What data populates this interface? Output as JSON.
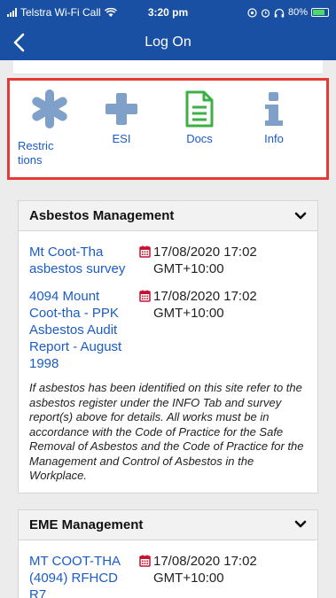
{
  "status_bar": {
    "carrier": "Telstra Wi-Fi Call",
    "time": "3:20 pm",
    "battery": "80%"
  },
  "nav": {
    "title": "Log On"
  },
  "toolbar": {
    "restrictions": "Restrictions",
    "esi": "ESI",
    "docs": "Docs",
    "info": "Info"
  },
  "sections": {
    "asbestos": {
      "title": "Asbestos Management",
      "documents": [
        {
          "title": "Mt Coot-Tha asbestos survey",
          "date": "17/08/2020 17:02 GMT+10:00"
        },
        {
          "title": "4094 Mount Coot-tha - PPK Asbestos Audit Report - August 1998",
          "date": "17/08/2020 17:02 GMT+10:00"
        }
      ],
      "note": "If asbestos has been identified on this site refer to the asbestos register under the INFO Tab and survey report(s) above for details. All works must be in accordance with the Code of Practice for the Safe Removal of Asbestos and the Code of Practice for the Management and Control of Asbestos in the Workplace."
    },
    "eme": {
      "title": "EME Management",
      "documents": [
        {
          "title": "MT COOT-THA (4094) RFHCD R7",
          "date": "17/08/2020 17:02 GMT+10:00"
        }
      ]
    }
  },
  "colors": {
    "header": "#1a50a3",
    "link": "#1a5cc8",
    "highlight_border": "#e53935",
    "docs_icon": "#3cb043",
    "tool_icon": "#7fa0c8"
  }
}
